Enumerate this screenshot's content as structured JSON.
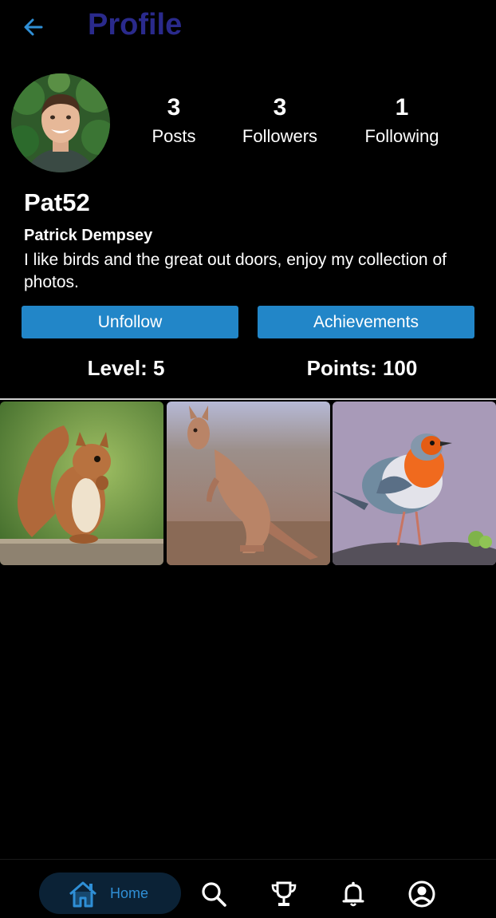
{
  "header": {
    "title": "Profile",
    "back_icon": "arrow-left-icon",
    "title_color": "#2a2a8c",
    "accent": "#2f8fd6"
  },
  "profile": {
    "username": "Pat52",
    "full_name": "Patrick Dempsey",
    "bio": "I like birds and the great out doors, enjoy my collection of photos."
  },
  "stats": [
    {
      "value": "3",
      "label": "Posts"
    },
    {
      "value": "3",
      "label": "Followers"
    },
    {
      "value": "1",
      "label": "Following"
    }
  ],
  "actions": {
    "unfollow_label": "Unfollow",
    "achievements_label": "Achievements",
    "button_color": "#2286c8"
  },
  "progress": {
    "level_text": "Level: 5",
    "points_text": "Points: 100"
  },
  "photos": [
    {
      "subject": "squirrel"
    },
    {
      "subject": "kangaroo"
    },
    {
      "subject": "robin"
    }
  ],
  "nav": {
    "home_label": "Home",
    "items": [
      "home-icon",
      "search-icon",
      "trophy-icon",
      "bell-icon",
      "profile-icon"
    ],
    "active": "home"
  }
}
